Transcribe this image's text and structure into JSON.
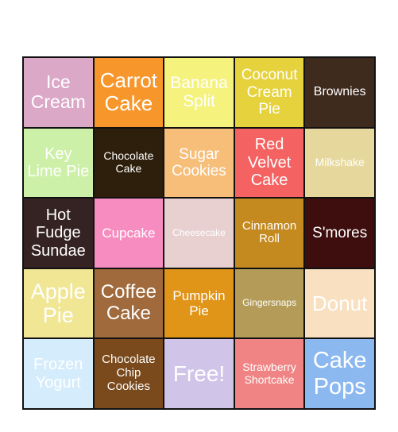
{
  "card": {
    "cells": [
      {
        "label": "Ice Cream",
        "color": "#dba8c8",
        "size": 23
      },
      {
        "label": "Carrot Cake",
        "color": "#f7962a",
        "size": 26
      },
      {
        "label": "Banana Split",
        "color": "#f5f27e",
        "size": 21
      },
      {
        "label": "Coconut Cream Pie",
        "color": "#e6d23c",
        "size": 19
      },
      {
        "label": "Brownies",
        "color": "#3f2a1e",
        "size": 16
      },
      {
        "label": "Key Lime Pie",
        "color": "#cdf0a8",
        "size": 20
      },
      {
        "label": "Chocolate Cake",
        "color": "#2e1f0c",
        "size": 14
      },
      {
        "label": "Sugar Cookies",
        "color": "#f7be7a",
        "size": 19
      },
      {
        "label": "Red Velvet Cake",
        "color": "#f56262",
        "size": 20
      },
      {
        "label": "Milkshake",
        "color": "#e6d89c",
        "size": 14
      },
      {
        "label": "Hot Fudge Sundae",
        "color": "#352222",
        "size": 20
      },
      {
        "label": "Cupcake",
        "color": "#f78cc0",
        "size": 17
      },
      {
        "label": "Cheesecake",
        "color": "#e8d0d0",
        "size": 12
      },
      {
        "label": "Cinnamon Roll",
        "color": "#c48a20",
        "size": 15
      },
      {
        "label": "S'mores",
        "color": "#3e0e0e",
        "size": 19
      },
      {
        "label": "Apple Pie",
        "color": "#f0e694",
        "size": 27
      },
      {
        "label": "Coffee Cake",
        "color": "#a06a3c",
        "size": 24
      },
      {
        "label": "Pumpkin Pie",
        "color": "#e09418",
        "size": 17
      },
      {
        "label": "Gingersnaps",
        "color": "#b49c58",
        "size": 12
      },
      {
        "label": "Donut",
        "color": "#f8e0c0",
        "size": 26
      },
      {
        "label": "Frozen Yogurt",
        "color": "#d4ecfc",
        "size": 20
      },
      {
        "label": "Chocolate Chip Cookies",
        "color": "#7a4a1c",
        "size": 15
      },
      {
        "label": "Free!",
        "color": "#d0c4e8",
        "size": 28
      },
      {
        "label": "Strawberry Shortcake",
        "color": "#f08484",
        "size": 14
      },
      {
        "label": "Cake Pops",
        "color": "#8cb8f0",
        "size": 29
      }
    ]
  }
}
